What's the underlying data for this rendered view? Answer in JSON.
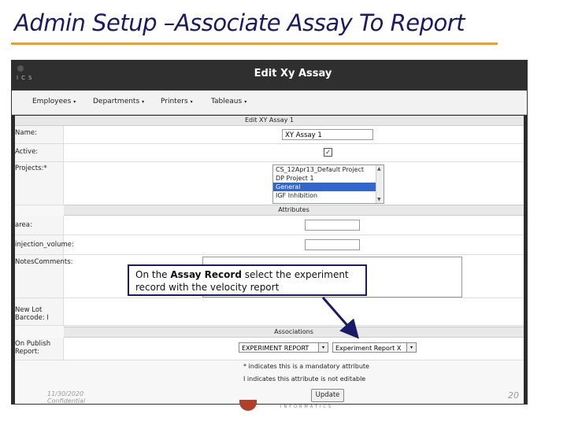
{
  "slide": {
    "title": "Admin Setup –Associate Assay To Report",
    "date": "11/30/2020",
    "confidential": "Confidential",
    "page_number": "20",
    "brand_text": "INFORMATICS"
  },
  "app": {
    "logo_text": "ICS",
    "header_title": "Edit Xy Assay"
  },
  "menu": {
    "items": [
      {
        "label": "Employees"
      },
      {
        "label": "Departments"
      },
      {
        "label": "Printers"
      },
      {
        "label": "Tableaus"
      }
    ],
    "caret": "▾"
  },
  "form": {
    "title": "Edit XY Assay 1",
    "name_label": "Name:",
    "name_value": "XY Assay 1",
    "active_label": "Active:",
    "active_checked": true,
    "active_mark": "✓",
    "projects_label": "Projects:*",
    "projects_options": [
      {
        "label": "CS_12Apr13_Default Project",
        "selected": false
      },
      {
        "label": "DP Project 1",
        "selected": false
      },
      {
        "label": "General",
        "selected": true
      },
      {
        "label": "IGF Inhibition",
        "selected": false
      }
    ],
    "attributes_section": "Attributes",
    "area_label": "area:",
    "injection_label": "injection_volume:",
    "notes_label": "NotesComments:",
    "newlot_label": "New Lot Barcode: I",
    "associations_section": "Associations",
    "on_publish_label": "On Publish Report:",
    "record_select": "EXPERIMENT REPORT",
    "report_select": "Experiment Report X",
    "mandatory_note": "* indicates this is a mandatory attribute",
    "noneditable_note": "I indicates this attribute is not editable",
    "update_button": "Update"
  },
  "callout": {
    "prefix": "On the ",
    "bold": "Assay Record",
    "suffix": " select the experiment record with the velocity report"
  },
  "colors": {
    "title": "#1a1a66",
    "rule": "#f0a020",
    "header": "#2f2f2f",
    "selection": "#3366cc"
  }
}
